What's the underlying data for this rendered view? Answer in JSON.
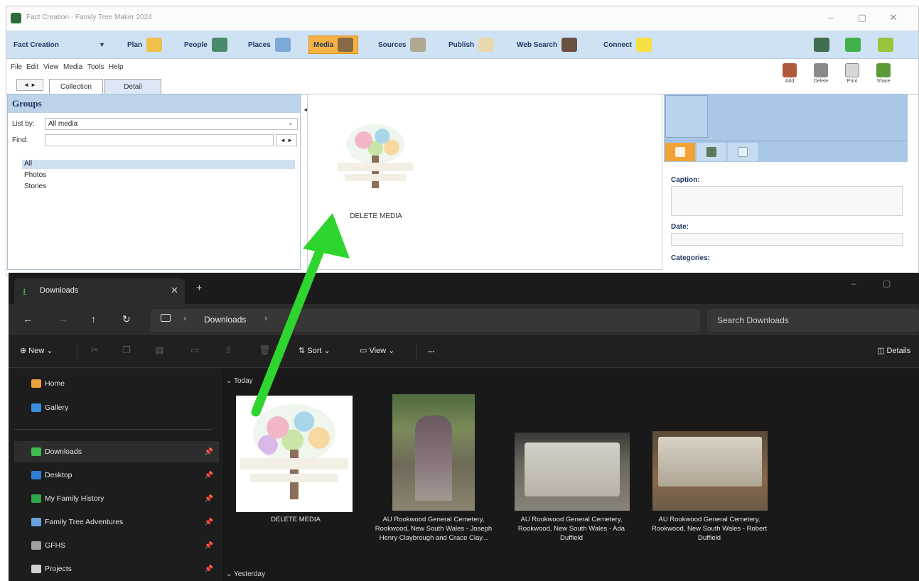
{
  "ftm": {
    "title": "Fact Creation - Family Tree Maker 2024",
    "nav": [
      {
        "label": "Fact Creation",
        "icon": "dropdown"
      },
      {
        "label": "Plan",
        "icon": "plan-icon",
        "color": "#f0c04a"
      },
      {
        "label": "People",
        "icon": "people-icon",
        "color": "#4a8a6a"
      },
      {
        "label": "Places",
        "icon": "places-icon",
        "color": "#7ea8d8"
      },
      {
        "label": "Media",
        "icon": "media-icon",
        "color": "#8a6a44"
      },
      {
        "label": "Sources",
        "icon": "sources-icon",
        "color": "#b0a890"
      },
      {
        "label": "Publish",
        "icon": "publish-icon",
        "color": "#e8d8b0"
      },
      {
        "label": "Web Search",
        "icon": "web-search-icon",
        "color": "#6a5040"
      },
      {
        "label": "Connect",
        "icon": "connect-icon",
        "color": "#f5e042"
      }
    ],
    "active_nav": "Media",
    "menu": [
      "File",
      "Edit",
      "View",
      "Media",
      "Tools",
      "Help"
    ],
    "toolbar": {
      "add": "Add",
      "delete": "Delete",
      "print": "Print",
      "share": "Share"
    },
    "tabs": {
      "collection": "Collection",
      "detail": "Detail"
    },
    "groups": {
      "header": "Groups",
      "list_by_label": "List by:",
      "list_by_value": "All media",
      "find_label": "Find:",
      "items": [
        "All",
        "Photos",
        "Stories"
      ]
    },
    "media_items": [
      {
        "label": "DELETE MEDIA"
      }
    ],
    "detail": {
      "caption_label": "Caption:",
      "date_label": "Date:",
      "categories_label": "Categories:"
    }
  },
  "explorer": {
    "tab_title": "Downloads",
    "path": "Downloads",
    "search_placeholder": "Search Downloads",
    "commands": {
      "new": "New",
      "sort": "Sort",
      "view": "View",
      "more": "...",
      "details": "Details"
    },
    "nav": [
      {
        "label": "Home",
        "icon": "home-icon",
        "color": "#e8a040",
        "pinned": false
      },
      {
        "label": "Gallery",
        "icon": "gallery-icon",
        "color": "#3a8ee0",
        "pinned": false
      },
      {
        "label": "Downloads",
        "icon": "downloads-icon",
        "color": "#3fb950",
        "pinned": true
      },
      {
        "label": "Desktop",
        "icon": "desktop-icon",
        "color": "#2f7fd6",
        "pinned": true
      },
      {
        "label": "My Family History",
        "icon": "tree-icon",
        "color": "#2ea84a",
        "pinned": true
      },
      {
        "label": "Family Tree Adventures",
        "icon": "share-icon",
        "color": "#6aa0e0",
        "pinned": true
      },
      {
        "label": "GFHS",
        "icon": "people-icon",
        "color": "#a0a0a0",
        "pinned": true
      },
      {
        "label": "Projects",
        "icon": "projects-icon",
        "color": "#d0d0d0",
        "pinned": true
      }
    ],
    "groups": {
      "today": "Today",
      "yesterday": "Yesterday"
    },
    "files": [
      {
        "name": "DELETE MEDIA",
        "kind": "tree-logo"
      },
      {
        "name": "AU Rookwood General Cemetery, Rookwood, New South Wales - Joseph Henry Claybrough and Grace Clay...",
        "kind": "grave-tall"
      },
      {
        "name": "AU Rookwood General Cemetery, Rookwood, New South Wales - Ada Duffield",
        "kind": "grave-flat"
      },
      {
        "name": "AU Rookwood General Cemetery, Rookwood, New South Wales - Robert Duffield",
        "kind": "grave-flat-2"
      }
    ]
  },
  "colors": {
    "ftm_nav_bg": "#cfe2f3",
    "active_tab": "#f7b142",
    "explorer_bg": "#202020",
    "arrow": "#2ed52e"
  }
}
